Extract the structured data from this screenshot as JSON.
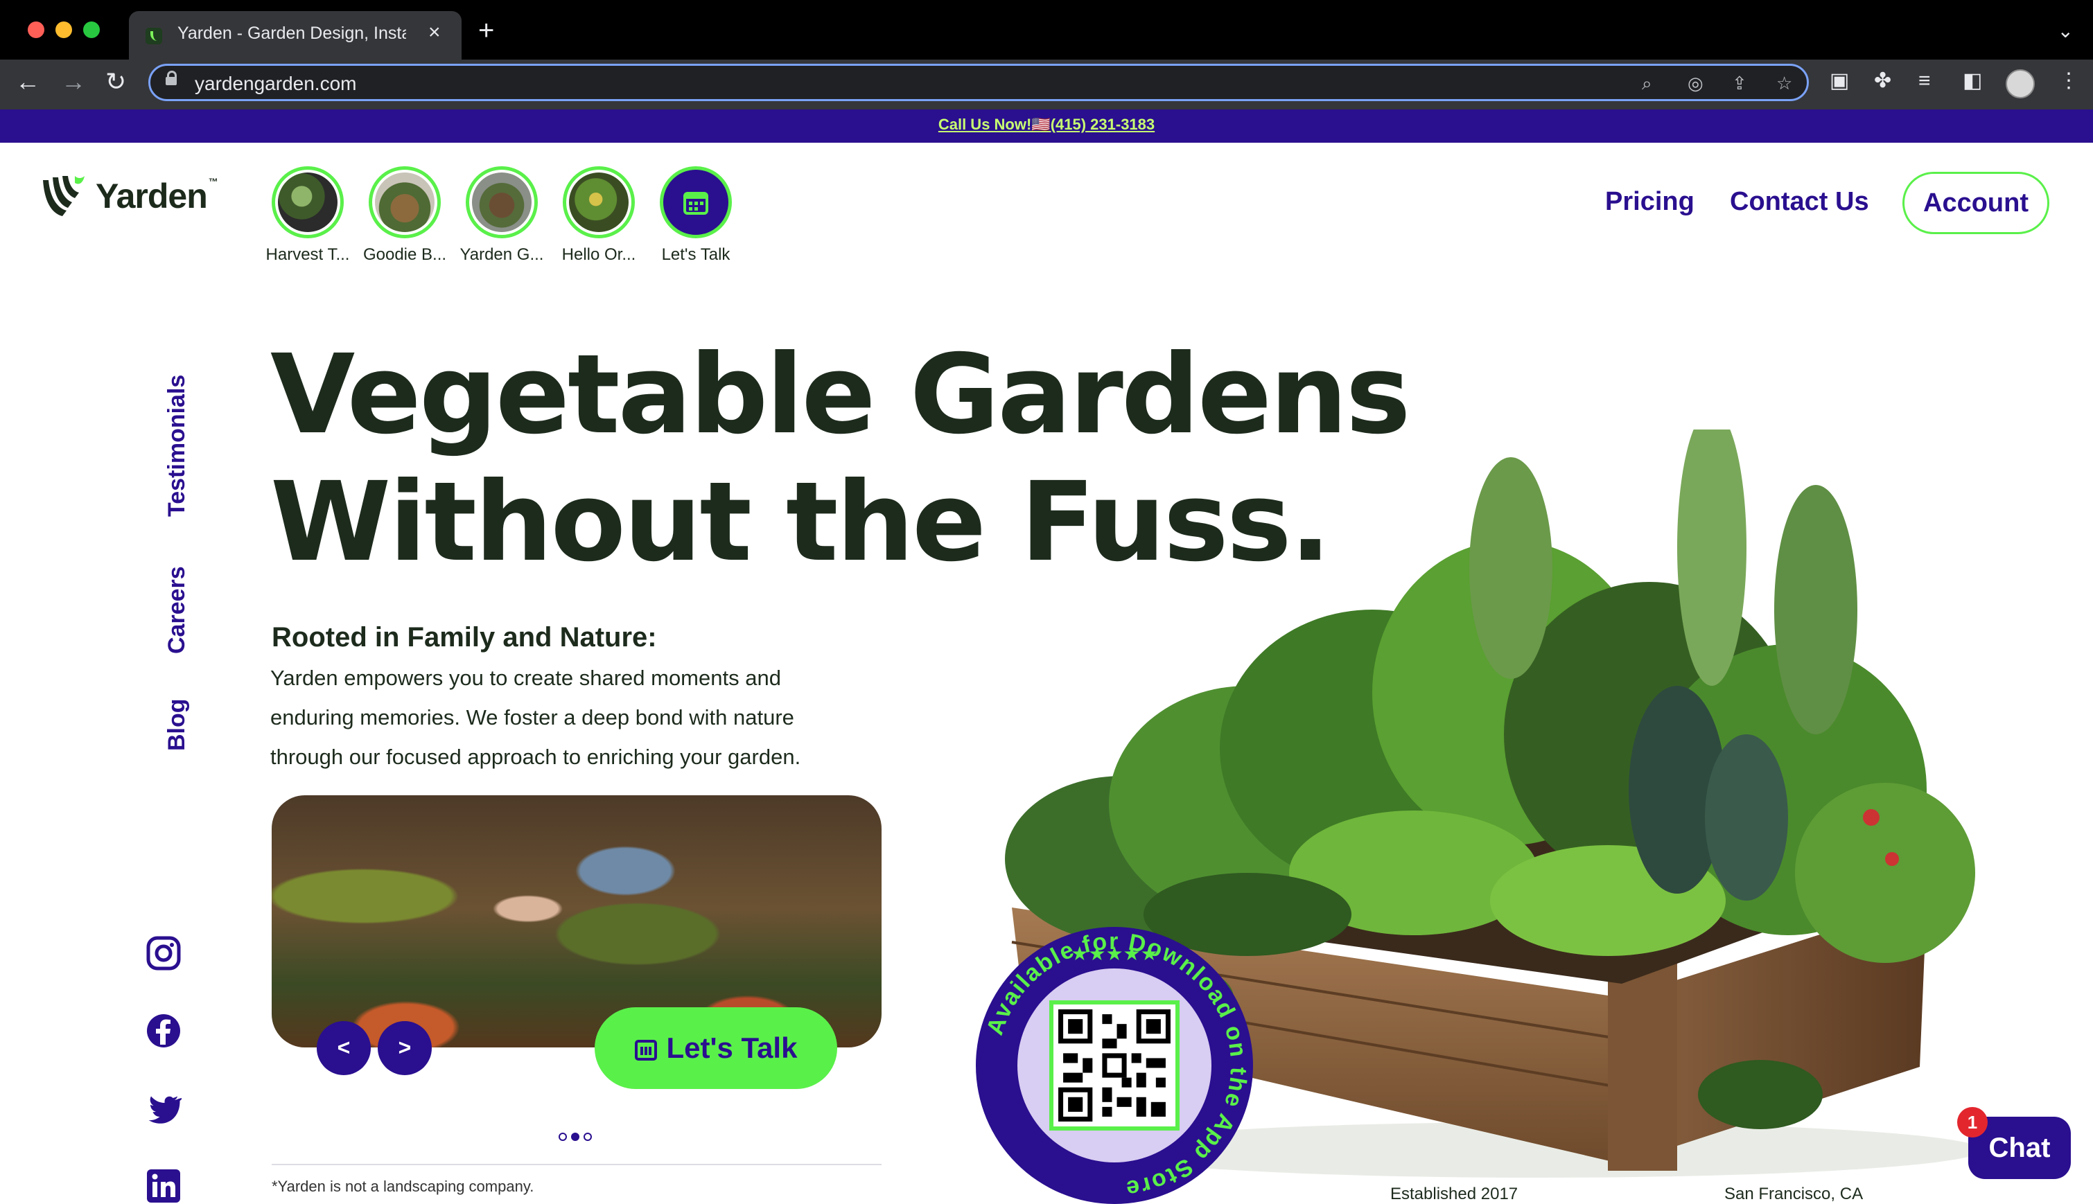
{
  "browser": {
    "tab_title": "Yarden - Garden Design, Install",
    "url": "yardengarden.com"
  },
  "announcement": {
    "text": "Call Us Now!🇺🇸(415) 231-3183"
  },
  "logo": {
    "name": "Yarden",
    "tm": "™"
  },
  "stories": [
    {
      "label": "Harvest T..."
    },
    {
      "label": "Goodie B..."
    },
    {
      "label": "Yarden G..."
    },
    {
      "label": "Hello Or..."
    },
    {
      "label": "Let's Talk"
    }
  ],
  "nav": {
    "pricing": "Pricing",
    "contact": "Contact Us",
    "account": "Account"
  },
  "side_links": {
    "testimonials": "Testimonials",
    "careers": "Careers",
    "blog": "Blog"
  },
  "social": [
    "instagram-icon",
    "facebook-icon",
    "twitter-icon",
    "linkedin-icon"
  ],
  "hero": {
    "title_line1": "Vegetable Gardens",
    "title_line2": "Without the Fuss.",
    "subheading": "Rooted in Family and Nature:",
    "body": "Yarden empowers you to create shared moments and enduring memories. We foster a deep bond with nature through our focused approach to enriching your garden.",
    "prev": "<",
    "next": ">",
    "cta": "Let's Talk",
    "disclaimer": "*Yarden is not a landscaping company."
  },
  "carousel": {
    "count": 3,
    "active": 2
  },
  "app_badge": {
    "stars": "★★★★★",
    "text": "Available for Download on the App Store"
  },
  "footer_facts": {
    "established": "Established 2017",
    "city": "San Francisco, CA"
  },
  "chat": {
    "label": "Chat",
    "badge": "1"
  },
  "colors": {
    "brand_purple": "#2a0f8f",
    "brand_green": "#5af04a",
    "heading": "#1d2b1d"
  }
}
